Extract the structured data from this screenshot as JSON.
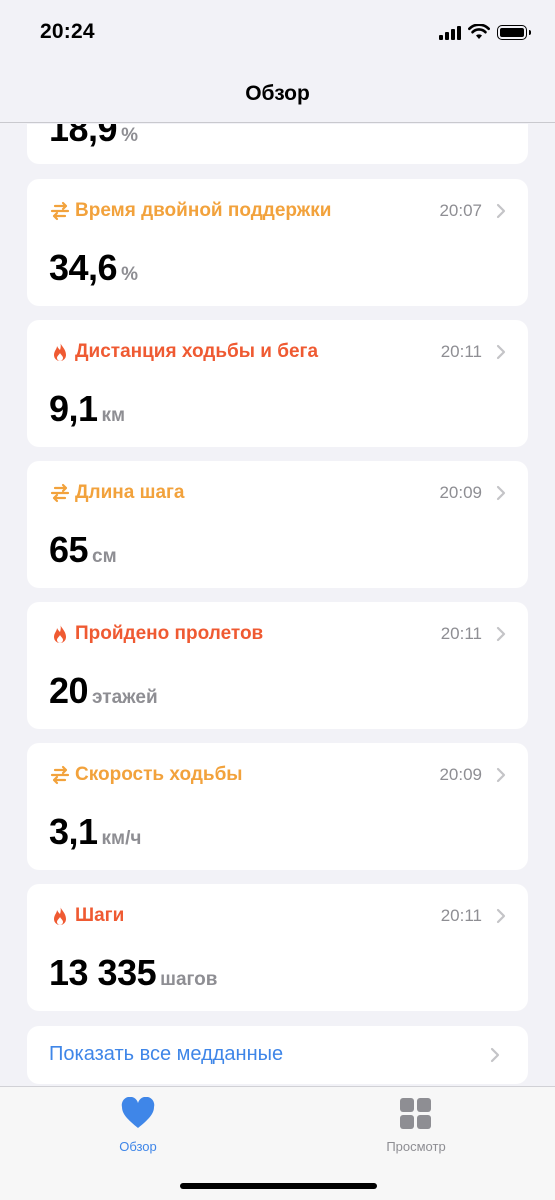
{
  "status_bar": {
    "time": "20:24"
  },
  "nav": {
    "title": "Обзор"
  },
  "partial_card": {
    "value": "18,9",
    "unit": "%"
  },
  "cards": [
    {
      "title": "Время двойной поддержки",
      "time": "20:07",
      "value": "34,6",
      "unit": "%",
      "icon": "arrows-icon",
      "color": "#f2a23c"
    },
    {
      "title": "Дистанция ходьбы и бега",
      "time": "20:11",
      "value": "9,1",
      "unit": "км",
      "icon": "flame-icon",
      "color": "#ef5a32"
    },
    {
      "title": "Длина шага",
      "time": "20:09",
      "value": "65",
      "unit": "см",
      "icon": "arrows-icon",
      "color": "#f2a23c"
    },
    {
      "title": "Пройдено пролетов",
      "time": "20:11",
      "value": "20",
      "unit": "этажей",
      "icon": "flame-icon",
      "color": "#ef5a32"
    },
    {
      "title": "Скорость ходьбы",
      "time": "20:09",
      "value": "3,1",
      "unit": "км/ч",
      "icon": "arrows-icon",
      "color": "#f2a23c"
    },
    {
      "title": "Шаги",
      "time": "20:11",
      "value": "13 335",
      "unit": "шагов",
      "icon": "flame-icon",
      "color": "#ef5a32"
    }
  ],
  "show_all": {
    "label": "Показать все медданные"
  },
  "tabs": [
    {
      "label": "Обзор",
      "icon": "heart-icon",
      "active": true
    },
    {
      "label": "Просмотр",
      "icon": "grid-icon",
      "active": false
    }
  ]
}
